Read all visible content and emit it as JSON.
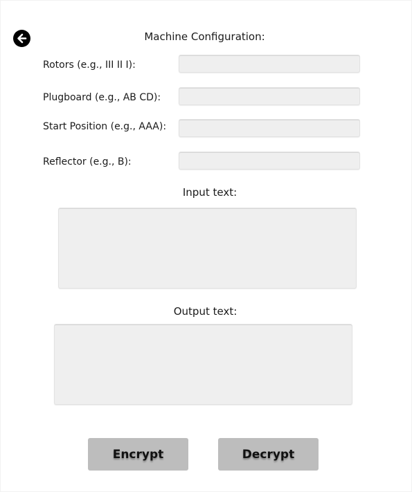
{
  "header": {
    "back_icon": "arrow-left-circle-icon",
    "title": "Machine Configuration:"
  },
  "config": {
    "rotors_label": "Rotors (e.g., III II I):",
    "rotors_value": "",
    "plugboard_label": "Plugboard (e.g., AB CD):",
    "plugboard_value": "",
    "start_position_label": "Start Position (e.g., AAA):",
    "start_position_value": "",
    "reflector_label": "Reflector (e.g., B):",
    "reflector_value": ""
  },
  "input": {
    "label": "Input text:",
    "value": ""
  },
  "output": {
    "label": "Output text:",
    "value": ""
  },
  "actions": {
    "encrypt_label": "Encrypt",
    "decrypt_label": "Decrypt"
  },
  "colors": {
    "field_background": "#efefef",
    "button_background": "#bdbdbd",
    "back_icon": "#000000"
  }
}
